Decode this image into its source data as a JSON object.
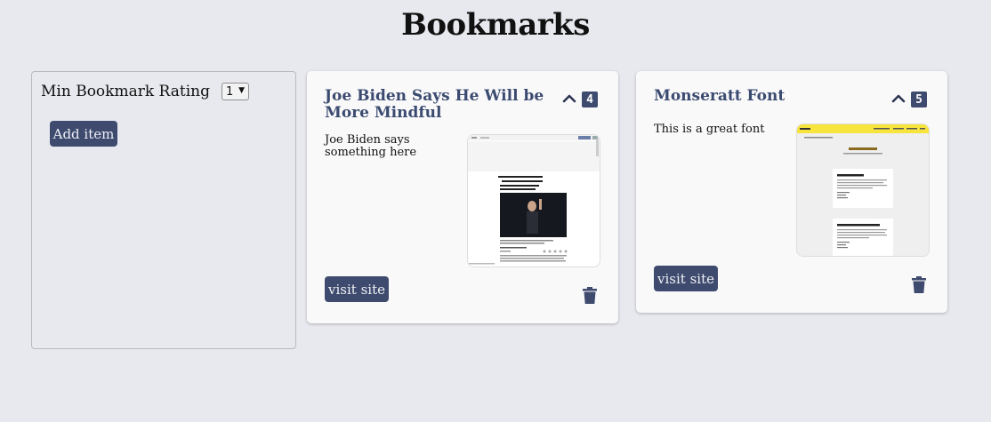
{
  "page": {
    "title": "Bookmarks"
  },
  "sidebar": {
    "rating_label": "Min Bookmark Rating",
    "rating_value": "1",
    "add_label": "Add item"
  },
  "cards": [
    {
      "title": "Joe Biden Says He Will be More Mindful",
      "rating": "4",
      "description": "Joe Biden says something here",
      "visit_label": "visit site",
      "thumb_headline": "Joe Biden, in Video, Says He Will Be 'More Mindful' of Personal Space",
      "thumb_brand": "The New York Times"
    },
    {
      "title": "Monseratt Font",
      "rating": "5",
      "description": "This is a great font",
      "visit_label": "visit site",
      "thumb_title": "Montserrat",
      "thumb_box1": "Montserrat & Cardo",
      "thumb_box2": "Montserrat & Crimson Text",
      "thumb_brand": "FontPair"
    }
  ],
  "colors": {
    "accent": "#3f4b6e",
    "title": "#3b4b70",
    "background": "#e8e9ef"
  },
  "icons": {
    "collapse": "chevron-up-icon",
    "delete": "trash-icon"
  }
}
